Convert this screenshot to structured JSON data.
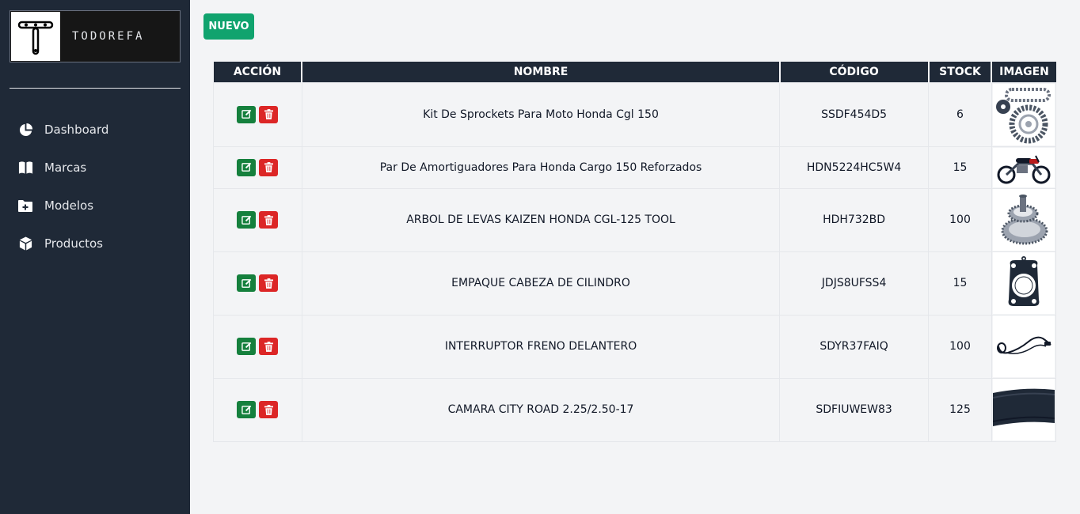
{
  "brand": {
    "name": "TODOREFA"
  },
  "sidebar": {
    "items": [
      {
        "label": "Dashboard",
        "icon": "pie-chart-icon"
      },
      {
        "label": "Marcas",
        "icon": "book-icon"
      },
      {
        "label": "Modelos",
        "icon": "folder-plus-icon"
      },
      {
        "label": "Productos",
        "icon": "box-icon"
      }
    ]
  },
  "toolbar": {
    "new_label": "NUEVO"
  },
  "table": {
    "headers": {
      "action": "ACCIÓN",
      "name": "NOMBRE",
      "code": "CÓDIGO",
      "stock": "STOCK",
      "image": "IMAGEN"
    },
    "rows": [
      {
        "name": "Kit De Sprockets Para Moto Honda Cgl 150",
        "code": "SSDF454D5",
        "stock": "6",
        "image": "sprocket-kit-image"
      },
      {
        "name": "Par De Amortiguadores Para Honda Cargo 150 Reforzados",
        "code": "HDN5224HC5W4",
        "stock": "15",
        "image": "motorcycle-image"
      },
      {
        "name": "ARBOL DE LEVAS KAIZEN HONDA CGL-125 TOOL",
        "code": "HDH732BD",
        "stock": "100",
        "image": "camshaft-gear-image"
      },
      {
        "name": "EMPAQUE CABEZA DE CILINDRO",
        "code": "JDJS8UFSS4",
        "stock": "15",
        "image": "cylinder-gasket-image"
      },
      {
        "name": "INTERRUPTOR FRENO DELANTERO",
        "code": "SDYR37FAIQ",
        "stock": "100",
        "image": "brake-switch-cable-image"
      },
      {
        "name": "CAMARA CITY ROAD 2.25/2.50-17",
        "code": "SDFIUWEW83",
        "stock": "125",
        "image": "inner-tube-image"
      }
    ]
  },
  "colors": {
    "sidebar_bg": "#1f2937",
    "page_bg": "#f3f4f6",
    "accent_green": "#10a36e",
    "edit_green": "#15803d",
    "delete_red": "#dc2626"
  }
}
